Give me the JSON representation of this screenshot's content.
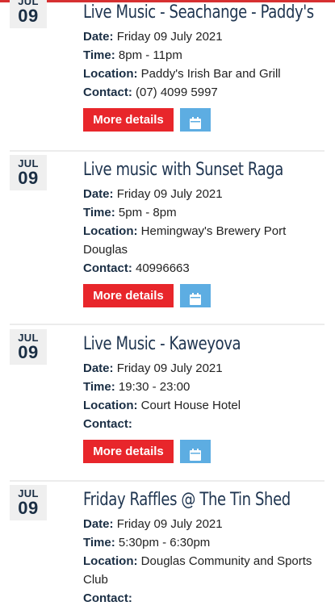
{
  "events": [
    {
      "month": "JUL",
      "day": "09",
      "title": "Live Music - Seachange - Paddy's",
      "date_label": "Date:",
      "date": "Friday 09 July 2021",
      "time_label": "Time:",
      "time": "8pm - 11pm",
      "location_label": "Location:",
      "location": "Paddy's Irish Bar and Grill",
      "contact_label": "Contact:",
      "contact": "(07) 4099 5997",
      "more_label": "More details",
      "calendar_icon": "calendar-icon"
    },
    {
      "month": "JUL",
      "day": "09",
      "title": "Live music with Sunset Raga",
      "date_label": "Date:",
      "date": "Friday 09 July 2021",
      "time_label": "Time:",
      "time": "5pm - 8pm",
      "location_label": "Location:",
      "location": "Hemingway's Brewery Port Douglas",
      "contact_label": "Contact:",
      "contact": "40996663",
      "more_label": "More details",
      "calendar_icon": "calendar-icon"
    },
    {
      "month": "JUL",
      "day": "09",
      "title": "Live Music - Kaweyova",
      "date_label": "Date:",
      "date": "Friday 09 July 2021",
      "time_label": "Time:",
      "time": "19:30 - 23:00",
      "location_label": "Location:",
      "location": "Court House Hotel",
      "contact_label": "Contact:",
      "contact": "",
      "more_label": "More details",
      "calendar_icon": "calendar-icon"
    },
    {
      "month": "JUL",
      "day": "09",
      "title": "Friday Raffles @ The Tin Shed",
      "date_label": "Date:",
      "date": "Friday 09 July 2021",
      "time_label": "Time:",
      "time": "5:30pm - 6:30pm",
      "location_label": "Location:",
      "location": "Douglas Community and Sports Club",
      "contact_label": "Contact:",
      "contact": ""
    }
  ],
  "colors": {
    "accent_red": "#e8262b",
    "calendar_blue": "#5dade2",
    "title_navy": "#1f3550",
    "badge_bg": "#efefef"
  }
}
